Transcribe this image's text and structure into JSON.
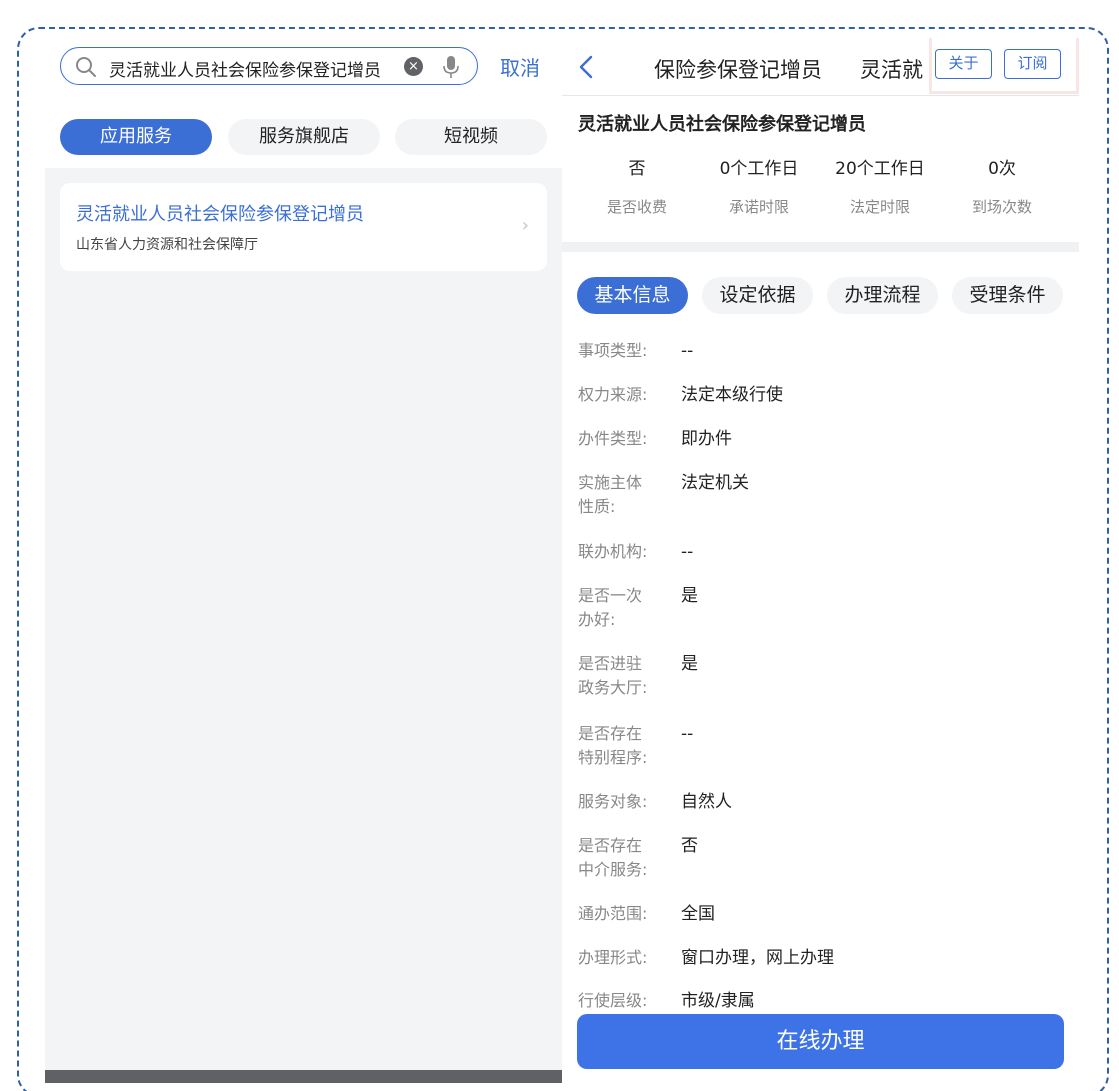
{
  "search": {
    "query": "灵活就业人员社会保险参保登记增员",
    "cancel_label": "取消"
  },
  "left_tabs": [
    {
      "label": "应用服务",
      "active": true
    },
    {
      "label": "服务旗舰店",
      "active": false
    },
    {
      "label": "短视频",
      "active": false
    }
  ],
  "result": {
    "title": "灵活就业人员社会保险参保登记增员",
    "org": "山东省人力资源和社会保障厅"
  },
  "detail_nav": {
    "title": "保险参保登记增员",
    "title_overflow": "灵活就",
    "about_label": "关于",
    "subscribe_label": "订阅"
  },
  "detail": {
    "title": "灵活就业人员社会保险参保登记增员",
    "stats": [
      {
        "value": "否",
        "label": "是否收费"
      },
      {
        "value": "0个工作日",
        "label": "承诺时限"
      },
      {
        "value": "20个工作日",
        "label": "法定时限"
      },
      {
        "value": "0次",
        "label": "到场次数"
      }
    ],
    "tabs": [
      {
        "label": "基本信息",
        "active": true
      },
      {
        "label": "设定依据",
        "active": false
      },
      {
        "label": "办理流程",
        "active": false
      },
      {
        "label": "受理条件",
        "active": false
      }
    ],
    "rows": [
      {
        "k1": "事项类型:",
        "k2": "",
        "v": "--"
      },
      {
        "k1": "权力来源:",
        "k2": "",
        "v": "法定本级行使"
      },
      {
        "k1": "办件类型:",
        "k2": "",
        "v": "即办件"
      },
      {
        "k1": "实施主体",
        "k2": "性质:",
        "v": "法定机关"
      },
      {
        "k1": "联办机构:",
        "k2": "",
        "v": "--"
      },
      {
        "k1": "是否一次",
        "k2": "办好:",
        "v": "是"
      },
      {
        "k1": "是否进驻",
        "k2": "政务大厅:",
        "v": "是"
      },
      {
        "k1": "是否存在",
        "k2": "特别程序:",
        "v": "--"
      },
      {
        "k1": "服务对象:",
        "k2": "",
        "v": "自然人"
      },
      {
        "k1": "是否存在",
        "k2": "中介服务:",
        "v": "否"
      },
      {
        "k1": "通办范围:",
        "k2": "",
        "v": "全国"
      },
      {
        "k1": "办理形式:",
        "k2": "",
        "v": "窗口办理，网上办理"
      },
      {
        "k1": "行使层级:",
        "k2": "",
        "v": "市级/隶属"
      }
    ],
    "action_label": "在线办理"
  },
  "colors": {
    "accent": "#3b6fd6",
    "button": "#3d73e6",
    "frame": "#2f5fa8"
  }
}
